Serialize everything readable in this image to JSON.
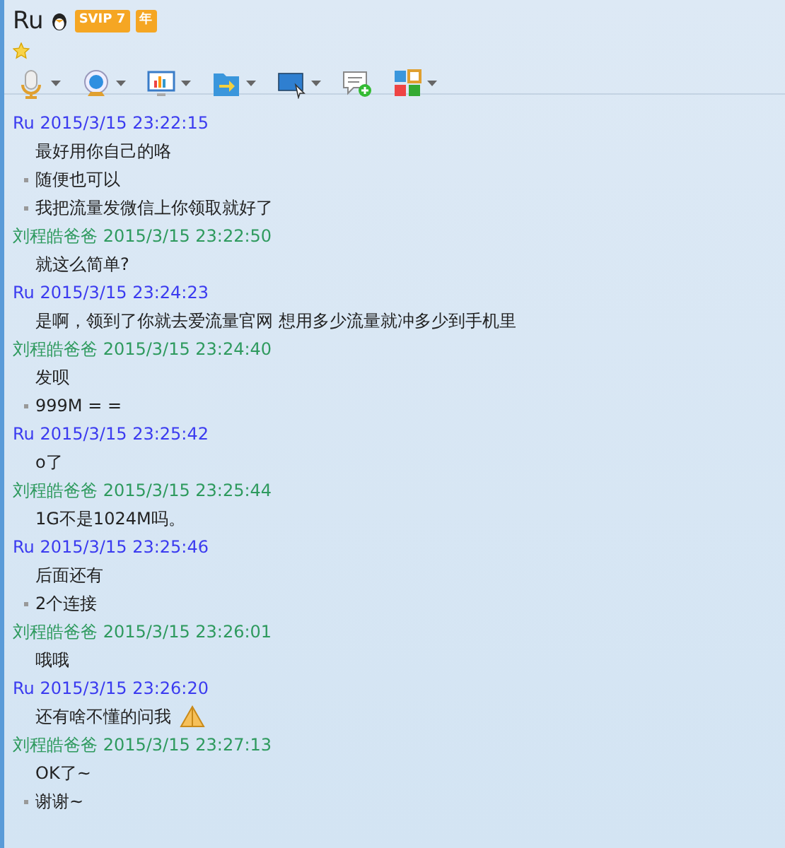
{
  "header": {
    "name": "Ru",
    "vip_badge": "SVIP 7",
    "year_badge": "年"
  },
  "toolbar": [
    {
      "kind": "mic",
      "caret": true
    },
    {
      "kind": "camera",
      "caret": true
    },
    {
      "kind": "screen",
      "caret": true
    },
    {
      "kind": "folder",
      "caret": true
    },
    {
      "kind": "remote",
      "caret": true
    },
    {
      "kind": "chat",
      "caret": false
    },
    {
      "kind": "apps",
      "caret": true
    }
  ],
  "messages": [
    {
      "sender": "Ru",
      "time": "2015/3/15 23:22:15",
      "color": "#3b3bf0",
      "lines": [
        {
          "text": "最好用你自己的咯",
          "bullet": false
        },
        {
          "text": "随便也可以",
          "bullet": true
        },
        {
          "text": "我把流量发微信上你领取就好了",
          "bullet": true
        }
      ]
    },
    {
      "sender": "刘程皓爸爸",
      "time": "2015/3/15 23:22:50",
      "color": "#2e9a5e",
      "lines": [
        {
          "text": "就这么简单?",
          "bullet": false
        }
      ]
    },
    {
      "sender": "Ru",
      "time": "2015/3/15 23:24:23",
      "color": "#3b3bf0",
      "lines": [
        {
          "text": "是啊，领到了你就去爱流量官网 想用多少流量就冲多少到手机里",
          "bullet": false
        }
      ]
    },
    {
      "sender": "刘程皓爸爸",
      "time": "2015/3/15 23:24:40",
      "color": "#2e9a5e",
      "lines": [
        {
          "text": "发呗",
          "bullet": false
        },
        {
          "text": "999M = =",
          "bullet": true
        }
      ]
    },
    {
      "sender": "Ru",
      "time": "2015/3/15 23:25:42",
      "color": "#3b3bf0",
      "lines": [
        {
          "text": "o了",
          "bullet": false
        }
      ]
    },
    {
      "sender": "刘程皓爸爸",
      "time": "2015/3/15 23:25:44",
      "color": "#2e9a5e",
      "lines": [
        {
          "text": "1G不是1024M吗。",
          "bullet": false
        }
      ]
    },
    {
      "sender": "Ru",
      "time": "2015/3/15 23:25:46",
      "color": "#3b3bf0",
      "lines": [
        {
          "text": "后面还有",
          "bullet": false
        },
        {
          "text": "2个连接",
          "bullet": true
        }
      ]
    },
    {
      "sender": "刘程皓爸爸",
      "time": "2015/3/15 23:26:01",
      "color": "#2e9a5e",
      "lines": [
        {
          "text": "哦哦",
          "bullet": false
        }
      ]
    },
    {
      "sender": "Ru",
      "time": "2015/3/15 23:26:20",
      "color": "#3b3bf0",
      "lines": [
        {
          "text": "还有啥不懂的问我",
          "bullet": false,
          "emoji": true
        }
      ]
    },
    {
      "sender": "刘程皓爸爸",
      "time": "2015/3/15 23:27:13",
      "color": "#2e9a5e",
      "lines": [
        {
          "text": "OK了~",
          "bullet": false
        },
        {
          "text": "谢谢~",
          "bullet": true
        }
      ]
    }
  ]
}
